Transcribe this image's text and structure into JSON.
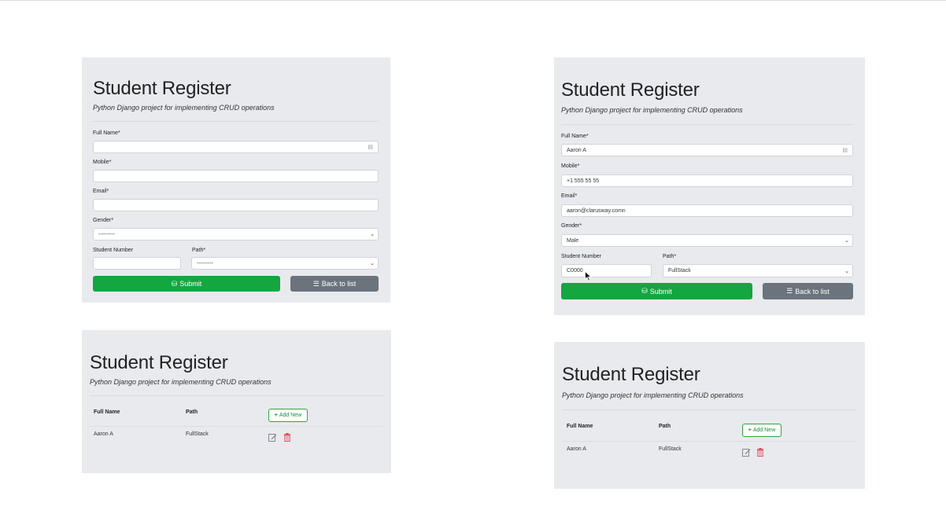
{
  "app": {
    "title": "Student Register",
    "subtitle": "Python Django project for implementing CRUD operations"
  },
  "form": {
    "full_name_label": "Full Name*",
    "mobile_label": "Mobile*",
    "email_label": "Email*",
    "gender_label": "Gender*",
    "student_number_label": "Student Number",
    "path_label": "Path*",
    "empty_select": "---------",
    "submit_label": "Submit",
    "back_label": "Back to list"
  },
  "filled_form": {
    "full_name": "Aaron A",
    "mobile": "+1 555 55 55",
    "email": "aaron@clarusway.comn",
    "gender": "Male",
    "student_number": "C0000",
    "path": "FullStack"
  },
  "list": {
    "col_full_name": "Full Name",
    "col_path": "Path",
    "add_new_label": "Add New",
    "rows": [
      {
        "full_name": "Aaron A",
        "path": "FullStack"
      }
    ]
  },
  "colors": {
    "panel_bg": "#e9eaee",
    "success": "#14a640",
    "secondary": "#6b737c",
    "danger": "#e0414f"
  },
  "icons": [
    "id-card-icon",
    "chevron-down-icon",
    "database-icon",
    "list-icon",
    "plus-icon",
    "edit-icon",
    "trash-icon",
    "mouse-cursor-icon"
  ]
}
